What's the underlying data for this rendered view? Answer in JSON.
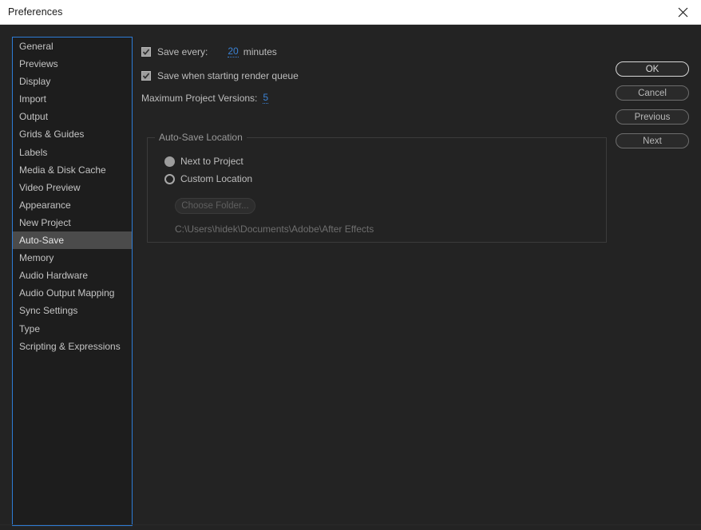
{
  "window": {
    "title": "Preferences",
    "close_icon": "close-icon"
  },
  "sidebar": {
    "items": [
      {
        "label": "General",
        "selected": false
      },
      {
        "label": "Previews",
        "selected": false
      },
      {
        "label": "Display",
        "selected": false
      },
      {
        "label": "Import",
        "selected": false
      },
      {
        "label": "Output",
        "selected": false
      },
      {
        "label": "Grids & Guides",
        "selected": false
      },
      {
        "label": "Labels",
        "selected": false
      },
      {
        "label": "Media & Disk Cache",
        "selected": false
      },
      {
        "label": "Video Preview",
        "selected": false
      },
      {
        "label": "Appearance",
        "selected": false
      },
      {
        "label": "New Project",
        "selected": false
      },
      {
        "label": "Auto-Save",
        "selected": true
      },
      {
        "label": "Memory",
        "selected": false
      },
      {
        "label": "Audio Hardware",
        "selected": false
      },
      {
        "label": "Audio Output Mapping",
        "selected": false
      },
      {
        "label": "Sync Settings",
        "selected": false
      },
      {
        "label": "Type",
        "selected": false
      },
      {
        "label": "Scripting & Expressions",
        "selected": false
      }
    ]
  },
  "main": {
    "save_every": {
      "label": "Save every:",
      "checked": true,
      "value": "20",
      "unit": "minutes"
    },
    "save_on_render_queue": {
      "label": "Save when starting render queue",
      "checked": true
    },
    "max_project_versions": {
      "label": "Maximum Project Versions:",
      "value": "5"
    },
    "auto_save_location": {
      "title": "Auto-Save Location",
      "options": [
        {
          "label": "Next to Project",
          "selected": true
        },
        {
          "label": "Custom Location",
          "selected": false
        }
      ],
      "choose_folder_label": "Choose Folder...",
      "choose_folder_enabled": false,
      "path": "C:\\Users\\hidek\\Documents\\Adobe\\After Effects"
    }
  },
  "buttons": [
    {
      "label": "OK",
      "primary": true
    },
    {
      "label": "Cancel",
      "primary": false
    },
    {
      "label": "Previous",
      "primary": false
    },
    {
      "label": "Next",
      "primary": false
    }
  ],
  "colors": {
    "titlebar_bg": "#ffffff",
    "dialog_bg": "#232323",
    "list_bg": "#1d1d1d",
    "focus_border": "#2d7cd6",
    "selection_bg": "#4b4b4b",
    "hot_text": "#3b82d4",
    "label_text": "#bdbdbd",
    "disabled_text": "#5f5f5f"
  }
}
